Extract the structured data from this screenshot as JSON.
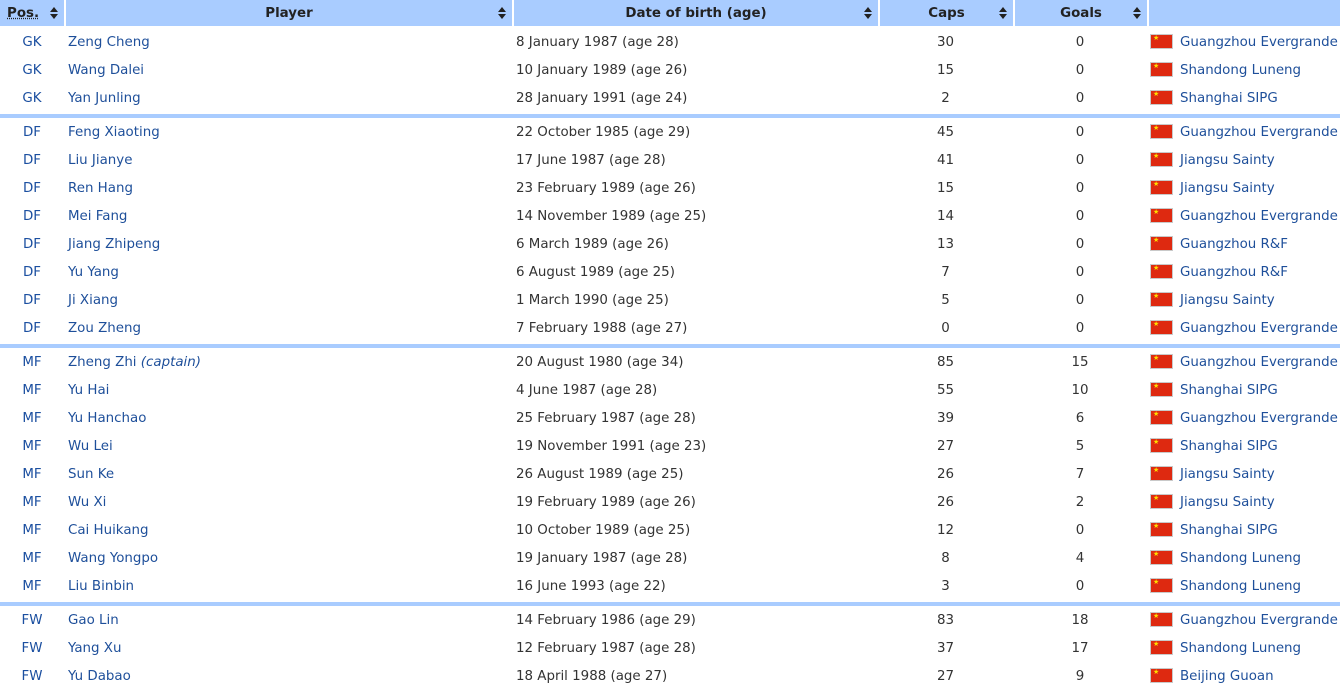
{
  "headers": {
    "pos": "Pos.",
    "player": "Player",
    "dob": "Date of birth (age)",
    "caps": "Caps",
    "goals": "Goals",
    "club": ""
  },
  "groups": [
    {
      "players": [
        {
          "pos": "GK",
          "name": "Zeng Cheng",
          "note": "",
          "dob": "8 January 1987 (age 28)",
          "caps": "30",
          "goals": "0",
          "club": "Guangzhou Evergrande"
        },
        {
          "pos": "GK",
          "name": "Wang Dalei",
          "note": "",
          "dob": "10 January 1989 (age 26)",
          "caps": "15",
          "goals": "0",
          "club": "Shandong Luneng"
        },
        {
          "pos": "GK",
          "name": "Yan Junling",
          "note": "",
          "dob": "28 January 1991 (age 24)",
          "caps": "2",
          "goals": "0",
          "club": "Shanghai SIPG"
        }
      ]
    },
    {
      "players": [
        {
          "pos": "DF",
          "name": "Feng Xiaoting",
          "note": "",
          "dob": "22 October 1985 (age 29)",
          "caps": "45",
          "goals": "0",
          "club": "Guangzhou Evergrande"
        },
        {
          "pos": "DF",
          "name": "Liu Jianye",
          "note": "",
          "dob": "17 June 1987 (age 28)",
          "caps": "41",
          "goals": "0",
          "club": "Jiangsu Sainty"
        },
        {
          "pos": "DF",
          "name": "Ren Hang",
          "note": "",
          "dob": "23 February 1989 (age 26)",
          "caps": "15",
          "goals": "0",
          "club": "Jiangsu Sainty"
        },
        {
          "pos": "DF",
          "name": "Mei Fang",
          "note": "",
          "dob": "14 November 1989 (age 25)",
          "caps": "14",
          "goals": "0",
          "club": "Guangzhou Evergrande"
        },
        {
          "pos": "DF",
          "name": "Jiang Zhipeng",
          "note": "",
          "dob": "6 March 1989 (age 26)",
          "caps": "13",
          "goals": "0",
          "club": "Guangzhou R&F"
        },
        {
          "pos": "DF",
          "name": "Yu Yang",
          "note": "",
          "dob": "6 August 1989 (age 25)",
          "caps": "7",
          "goals": "0",
          "club": "Guangzhou R&F"
        },
        {
          "pos": "DF",
          "name": "Ji Xiang",
          "note": "",
          "dob": "1 March 1990 (age 25)",
          "caps": "5",
          "goals": "0",
          "club": "Jiangsu Sainty"
        },
        {
          "pos": "DF",
          "name": "Zou Zheng",
          "note": "",
          "dob": "7 February 1988 (age 27)",
          "caps": "0",
          "goals": "0",
          "club": "Guangzhou Evergrande"
        }
      ]
    },
    {
      "players": [
        {
          "pos": "MF",
          "name": "Zheng Zhi",
          "note": "(captain)",
          "dob": "20 August 1980 (age 34)",
          "caps": "85",
          "goals": "15",
          "club": "Guangzhou Evergrande"
        },
        {
          "pos": "MF",
          "name": "Yu Hai",
          "note": "",
          "dob": "4 June 1987 (age 28)",
          "caps": "55",
          "goals": "10",
          "club": "Shanghai SIPG"
        },
        {
          "pos": "MF",
          "name": "Yu Hanchao",
          "note": "",
          "dob": "25 February 1987 (age 28)",
          "caps": "39",
          "goals": "6",
          "club": "Guangzhou Evergrande"
        },
        {
          "pos": "MF",
          "name": "Wu Lei",
          "note": "",
          "dob": "19 November 1991 (age 23)",
          "caps": "27",
          "goals": "5",
          "club": "Shanghai SIPG"
        },
        {
          "pos": "MF",
          "name": "Sun Ke",
          "note": "",
          "dob": "26 August 1989 (age 25)",
          "caps": "26",
          "goals": "7",
          "club": "Jiangsu Sainty"
        },
        {
          "pos": "MF",
          "name": "Wu Xi",
          "note": "",
          "dob": "19 February 1989 (age 26)",
          "caps": "26",
          "goals": "2",
          "club": "Jiangsu Sainty"
        },
        {
          "pos": "MF",
          "name": "Cai Huikang",
          "note": "",
          "dob": "10 October 1989 (age 25)",
          "caps": "12",
          "goals": "0",
          "club": "Shanghai SIPG"
        },
        {
          "pos": "MF",
          "name": "Wang Yongpo",
          "note": "",
          "dob": "19 January 1987 (age 28)",
          "caps": "8",
          "goals": "4",
          "club": "Shandong Luneng"
        },
        {
          "pos": "MF",
          "name": "Liu Binbin",
          "note": "",
          "dob": "16 June 1993 (age 22)",
          "caps": "3",
          "goals": "0",
          "club": "Shandong Luneng"
        }
      ]
    },
    {
      "players": [
        {
          "pos": "FW",
          "name": "Gao Lin",
          "note": "",
          "dob": "14 February 1986 (age 29)",
          "caps": "83",
          "goals": "18",
          "club": "Guangzhou Evergrande"
        },
        {
          "pos": "FW",
          "name": "Yang Xu",
          "note": "",
          "dob": "12 February 1987 (age 28)",
          "caps": "37",
          "goals": "17",
          "club": "Shandong Luneng"
        },
        {
          "pos": "FW",
          "name": "Yu Dabao",
          "note": "",
          "dob": "18 April 1988 (age 27)",
          "caps": "27",
          "goals": "9",
          "club": "Beijing Guoan"
        }
      ]
    }
  ],
  "colors": {
    "header_bg": "#a9ccff",
    "link": "#1e4f9a",
    "flag_red": "#de2910",
    "flag_star": "#ffde00"
  },
  "icons": {
    "sort": "sort-arrows-icon",
    "flag": "china-flag-icon"
  }
}
